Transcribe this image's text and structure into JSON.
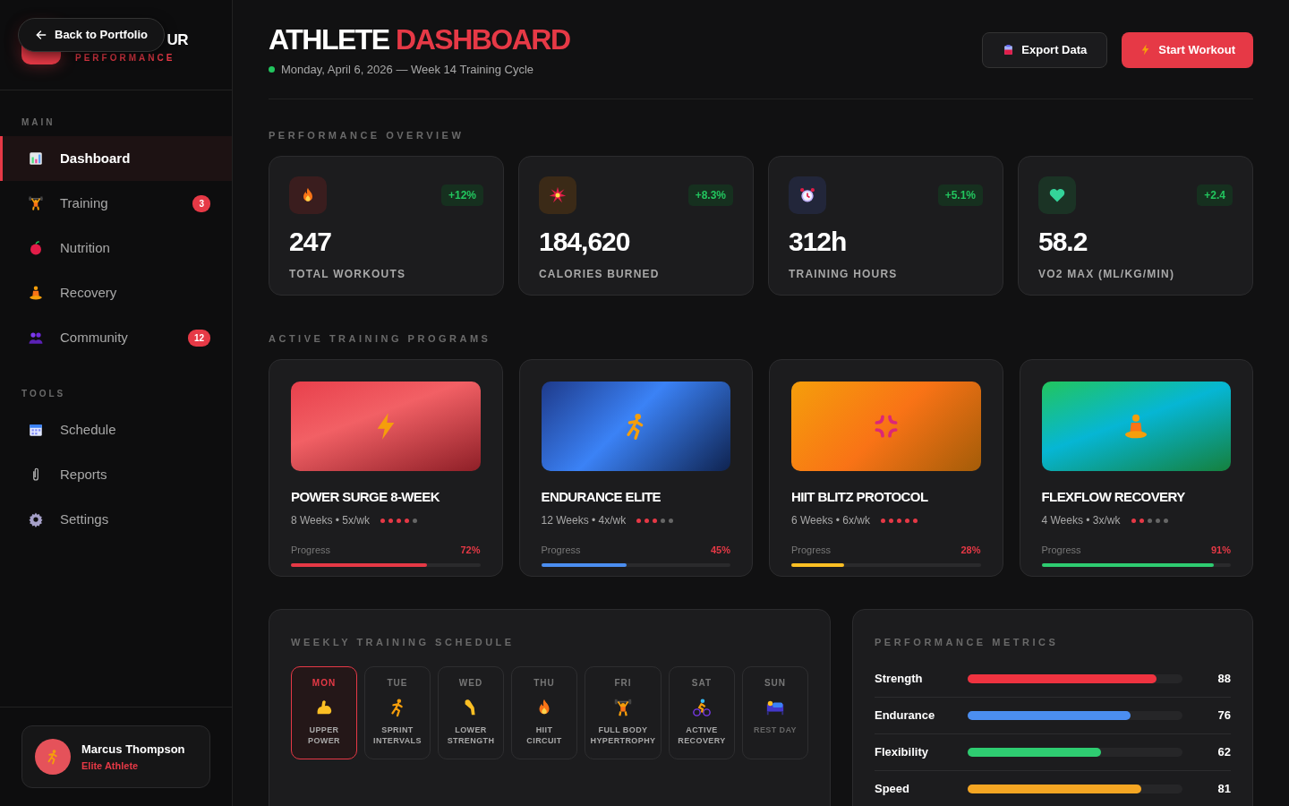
{
  "sidebar": {
    "back_button": "Back to Portfolio",
    "logo": {
      "title": "UR",
      "subtitle": "PERFORMANCE"
    },
    "sections": [
      {
        "label": "MAIN",
        "items": [
          {
            "label": "Dashboard",
            "selected": true
          },
          {
            "label": "Training",
            "selected": false,
            "badge": "3"
          },
          {
            "label": "Nutrition",
            "selected": false
          },
          {
            "label": "Recovery",
            "selected": false
          },
          {
            "label": "Community",
            "selected": false,
            "badge": "12"
          }
        ]
      },
      {
        "label": "TOOLS",
        "items": [
          {
            "label": "Schedule",
            "selected": false
          },
          {
            "label": "Reports",
            "selected": false
          },
          {
            "label": "Settings",
            "selected": false
          }
        ]
      }
    ],
    "user": {
      "name": "Marcus Thompson",
      "role": "Elite Athlete"
    }
  },
  "header": {
    "title_main": "ATHLETE",
    "title_accent": "DASHBOARD",
    "subtitle": "Monday, April 6, 2026 — Week 14 Training Cycle",
    "buttons": [
      "Export Data",
      "Start Workout"
    ]
  },
  "overview": {
    "label": "PERFORMANCE OVERVIEW",
    "stats": [
      {
        "value": "247",
        "label": "TOTAL WORKOUTS",
        "change": "+12%"
      },
      {
        "value": "184,620",
        "label": "CALORIES BURNED",
        "change": "+8.3%"
      },
      {
        "value": "312h",
        "label": "TRAINING HOURS",
        "change": "+5.1%"
      },
      {
        "value": "58.2",
        "label": "VO2 MAX (ML/KG/MIN)",
        "change": "+2.4"
      }
    ]
  },
  "programs": {
    "label": "ACTIVE TRAINING PROGRAMS",
    "items": [
      {
        "title": "POWER SURGE 8-WEEK",
        "meta": "8 Weeks • 5x/wk",
        "stars": 4,
        "progress_label": "Progress",
        "progress_text": "72%",
        "level": 0.72,
        "color": "#e63946"
      },
      {
        "title": "ENDURANCE ELITE",
        "meta": "12 Weeks • 4x/wk",
        "stars": 3,
        "progress_label": "Progress",
        "progress_text": "45%",
        "level": 0.45,
        "color": "#4b8ef0"
      },
      {
        "title": "HIIT BLITZ PROTOCOL",
        "meta": "6 Weeks • 6x/wk",
        "stars": 5,
        "progress_label": "Progress",
        "progress_text": "28%",
        "level": 0.28,
        "color": "#fbbf24"
      },
      {
        "title": "FLEXFLOW RECOVERY",
        "meta": "4 Weeks • 3x/wk",
        "stars": 2,
        "progress_label": "Progress",
        "progress_text": "91%",
        "level": 0.91,
        "color": "#2ecc71"
      }
    ]
  },
  "schedule": {
    "label": "WEEKLY TRAINING SCHEDULE",
    "days": [
      {
        "day": "MON",
        "workout": "UPPER POWER",
        "selected": true,
        "kind": "workout"
      },
      {
        "day": "TUE",
        "workout": "SPRINT INTERVALS",
        "selected": false,
        "kind": "workout"
      },
      {
        "day": "WED",
        "workout": "LOWER STRENGTH",
        "selected": false,
        "kind": "workout"
      },
      {
        "day": "THU",
        "workout": "HIIT CIRCUIT",
        "selected": false,
        "kind": "workout"
      },
      {
        "day": "FRI",
        "workout": "FULL BODY HYPERTROPHY",
        "selected": false,
        "kind": "workout"
      },
      {
        "day": "SAT",
        "workout": "ACTIVE RECOVERY",
        "selected": false,
        "kind": "workout"
      },
      {
        "day": "SUN",
        "workout": "REST DAY",
        "selected": false,
        "kind": "rest"
      }
    ]
  },
  "metrics": {
    "label": "PERFORMANCE METRICS",
    "items": [
      {
        "name": "Strength",
        "level": 0.88,
        "value": "88",
        "color": "#ef3340"
      },
      {
        "name": "Endurance",
        "level": 0.76,
        "value": "76",
        "color": "#4b8ef0"
      },
      {
        "name": "Flexibility",
        "level": 0.62,
        "value": "62",
        "color": "#2ecc71"
      },
      {
        "name": "Speed",
        "level": 0.81,
        "value": "81",
        "color": "#f5a623"
      }
    ]
  }
}
